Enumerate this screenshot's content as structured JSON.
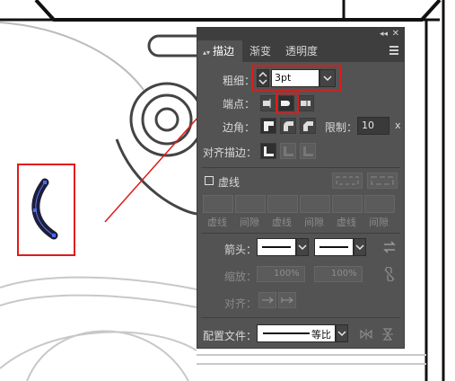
{
  "panel": {
    "collapse_glyph": "◂◂",
    "close_glyph": "✕",
    "tabs": [
      {
        "label": "描边",
        "active": true
      },
      {
        "label": "渐变",
        "active": false
      },
      {
        "label": "透明度",
        "active": false
      }
    ],
    "weight": {
      "label": "粗细：",
      "value": "3pt"
    },
    "cap": {
      "label": "端点：",
      "options": [
        "butt-cap",
        "round-cap",
        "projecting-cap"
      ],
      "selected": "round-cap"
    },
    "corner": {
      "label": "边角：",
      "options": [
        "miter-join",
        "round-join",
        "bevel-join"
      ],
      "limit_label": "限制：",
      "limit_value": "10",
      "limit_unit": "x"
    },
    "align": {
      "label": "对齐描边：",
      "options": [
        "align-center",
        "align-inside",
        "align-outside"
      ]
    },
    "dashed": {
      "label": "虚线",
      "checked": false,
      "slot_labels": [
        "虚线",
        "间隙",
        "虚线",
        "间隙",
        "虚线",
        "间隙"
      ]
    },
    "arrowheads": {
      "label": "箭头："
    },
    "scale": {
      "label": "缩放：",
      "start": "100%",
      "end": "100%"
    },
    "arrow_align": {
      "label": "对齐："
    },
    "profile": {
      "label": "配置文件：",
      "value": "等比"
    }
  },
  "colors": {
    "panel_bg": "#535353",
    "highlight": "#e01a1a",
    "path_fill": "#1e1e3a",
    "anchor": "#4a6cf0"
  }
}
